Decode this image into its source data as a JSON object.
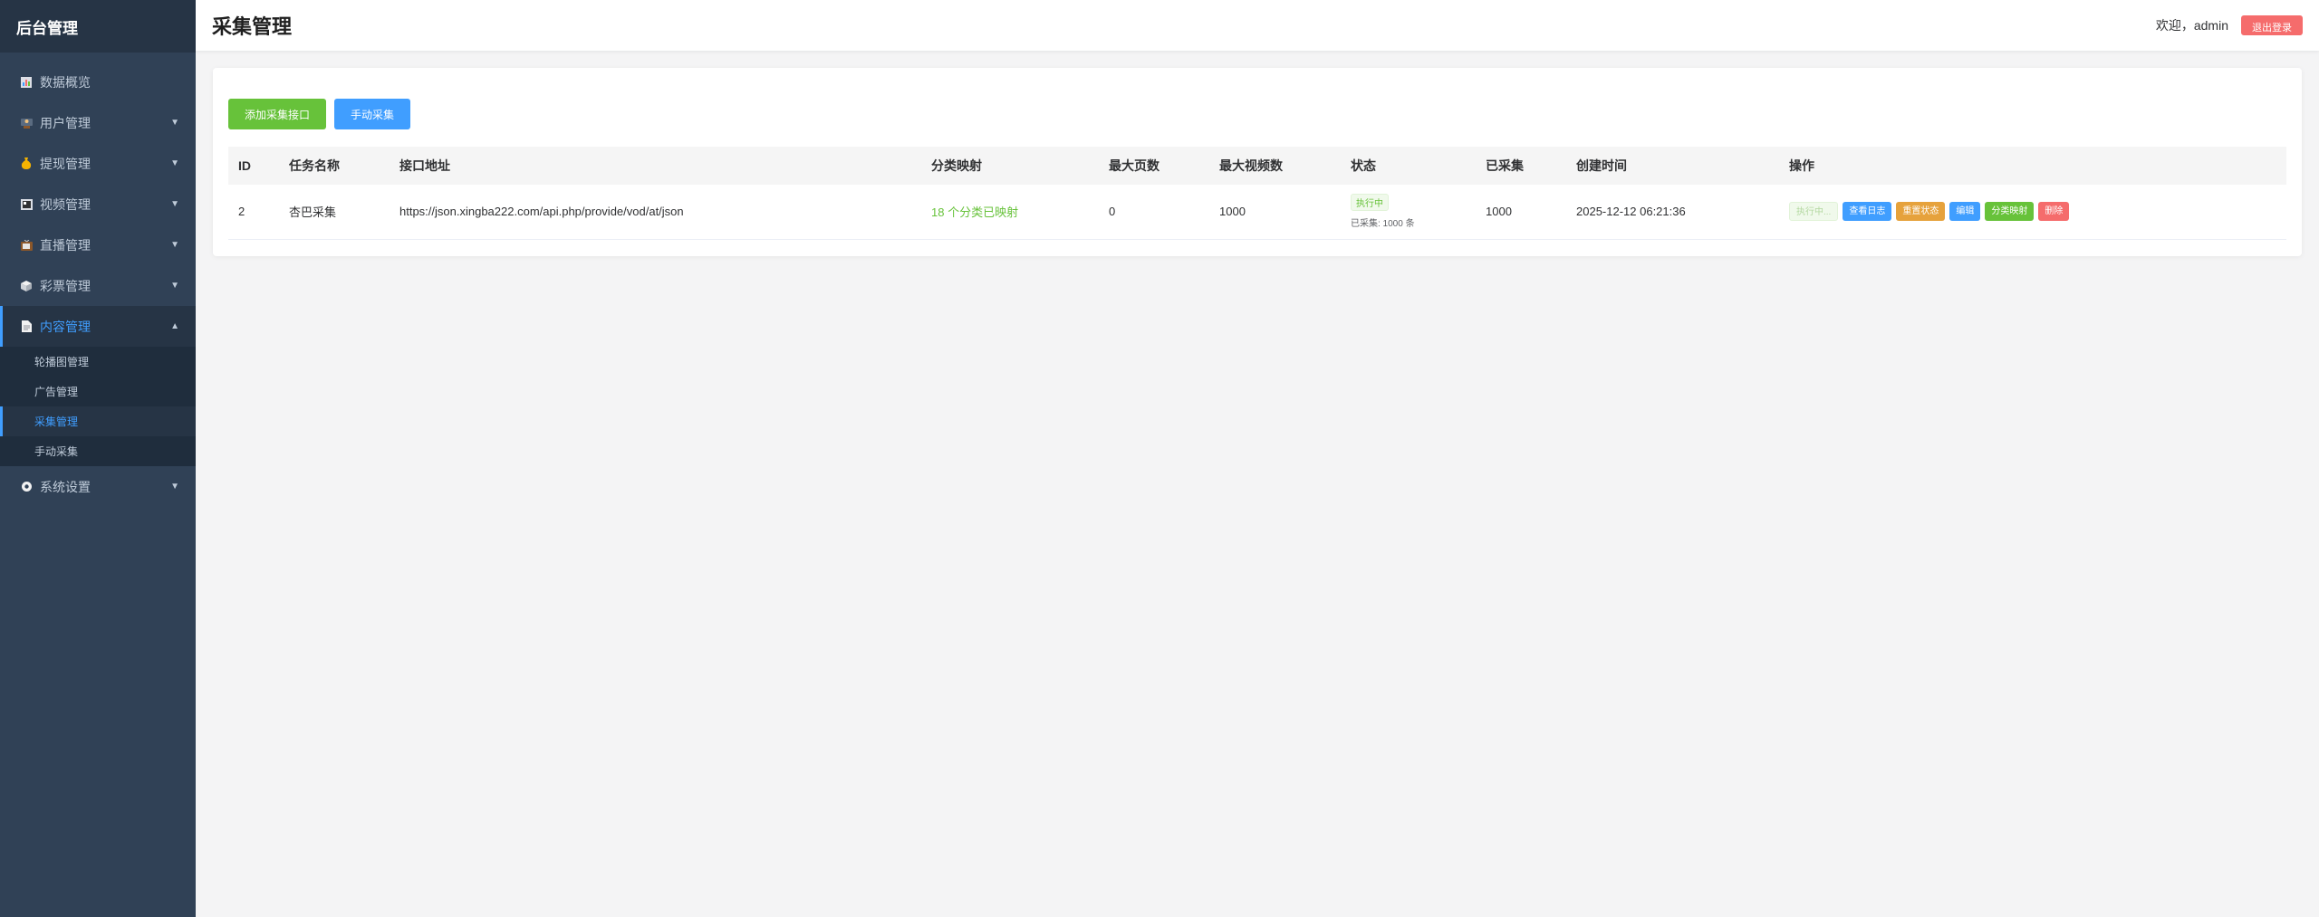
{
  "app": {
    "brand": "后台管理"
  },
  "sidebar": {
    "items": [
      {
        "label": "数据概览",
        "icon": "chart-icon",
        "has_children": false
      },
      {
        "label": "用户管理",
        "icon": "user-icon",
        "has_children": true
      },
      {
        "label": "提现管理",
        "icon": "money-bag-icon",
        "has_children": true
      },
      {
        "label": "视频管理",
        "icon": "film-icon",
        "has_children": true
      },
      {
        "label": "直播管理",
        "icon": "tv-icon",
        "has_children": true
      },
      {
        "label": "彩票管理",
        "icon": "cube-icon",
        "has_children": true
      },
      {
        "label": "内容管理",
        "icon": "document-icon",
        "has_children": true,
        "expanded": true
      },
      {
        "label": "系统设置",
        "icon": "gear-icon",
        "has_children": true
      }
    ],
    "content_submenu": [
      "轮播图管理",
      "广告管理",
      "采集管理",
      "手动采集"
    ],
    "active_submenu": "采集管理"
  },
  "header": {
    "title": "采集管理",
    "welcome": "欢迎，admin",
    "logout_label": "退出登录"
  },
  "toolbar": {
    "add_label": "添加采集接口",
    "manual_label": "手动采集"
  },
  "table": {
    "columns": [
      "ID",
      "任务名称",
      "接口地址",
      "分类映射",
      "最大页数",
      "最大视频数",
      "状态",
      "已采集",
      "创建时间",
      "操作"
    ],
    "rows": [
      {
        "id": "2",
        "name": "杏巴采集",
        "url": "https://json.xingba222.com/api.php/provide/vod/at/json",
        "mapping": "18 个分类已映射",
        "max_pages": "0",
        "max_videos": "1000",
        "status_tag": "执行中",
        "status_sub": "已采集: 1000 条",
        "collected": "1000",
        "created": "2025-12-12 06:21:36",
        "ops": {
          "running": "执行中...",
          "view_log": "查看日志",
          "reset_status": "重置状态",
          "edit": "编辑",
          "category_map": "分类映射",
          "delete": "删除"
        }
      }
    ]
  },
  "colors": {
    "sidebar_bg": "#304156",
    "accent": "#409eff",
    "success": "#67c23a",
    "warning": "#e6a23c",
    "danger": "#f56c6c"
  }
}
